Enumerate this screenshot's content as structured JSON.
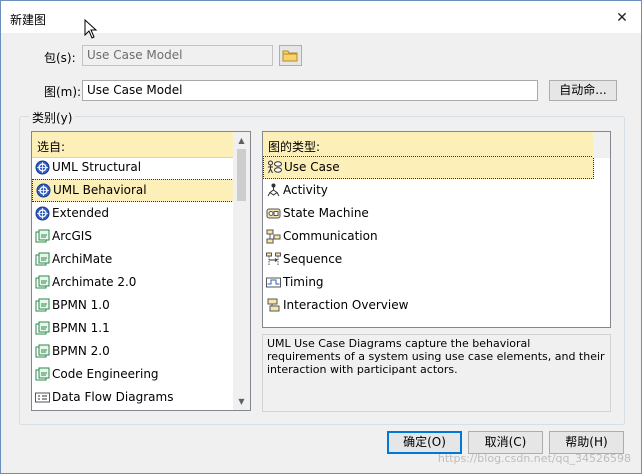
{
  "window": {
    "title": "新建图",
    "close_glyph": "✕"
  },
  "package": {
    "label": "包(s):",
    "value": "Use Case Model"
  },
  "diagram": {
    "label": "图(m):",
    "value": "Use Case Model",
    "auto_name_button": "自动命..."
  },
  "category": {
    "label": "类别(y)"
  },
  "select_from": {
    "header": "选自:",
    "items": [
      {
        "label": "UML Structural",
        "icon": "uml-icon"
      },
      {
        "label": "UML Behavioral",
        "icon": "uml-icon"
      },
      {
        "label": "Extended",
        "icon": "uml-icon"
      },
      {
        "label": "ArcGIS",
        "icon": "mdg-icon"
      },
      {
        "label": "ArchiMate",
        "icon": "mdg-icon"
      },
      {
        "label": "Archimate 2.0",
        "icon": "mdg-icon"
      },
      {
        "label": "BPMN 1.0",
        "icon": "mdg-icon"
      },
      {
        "label": "BPMN 1.1",
        "icon": "mdg-icon"
      },
      {
        "label": "BPMN 2.0",
        "icon": "mdg-icon"
      },
      {
        "label": "Code Engineering",
        "icon": "mdg-icon"
      },
      {
        "label": "Data Flow Diagrams",
        "icon": "dfd-icon"
      }
    ],
    "selected": "UML Behavioral"
  },
  "diagram_types": {
    "header": "图的类型:",
    "items": [
      {
        "label": "Use Case",
        "icon": "use-case-icon"
      },
      {
        "label": "Activity",
        "icon": "activity-icon"
      },
      {
        "label": "State Machine",
        "icon": "state-machine-icon"
      },
      {
        "label": "Communication",
        "icon": "communication-icon"
      },
      {
        "label": "Sequence",
        "icon": "sequence-icon"
      },
      {
        "label": "Timing",
        "icon": "timing-icon"
      },
      {
        "label": "Interaction Overview",
        "icon": "interaction-overview-icon"
      }
    ],
    "selected": "Use Case"
  },
  "description": "UML Use Case Diagrams capture the behavioral requirements of a system using use case elements, and their interaction with participant actors.",
  "buttons": {
    "ok": "确定(O)",
    "cancel": "取消(C)",
    "help": "帮助(H)"
  },
  "watermark": "https://blog.csdn.net/qq_34526598",
  "colors": {
    "selection": "#fcefb8",
    "accent": "#0078d7"
  }
}
